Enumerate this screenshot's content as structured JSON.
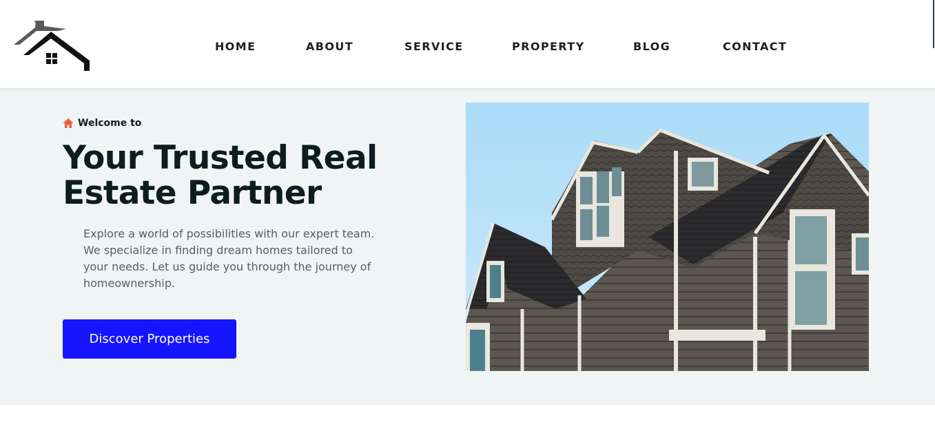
{
  "nav": {
    "items": [
      {
        "label": "HOME"
      },
      {
        "label": "ABOUT"
      },
      {
        "label": "SERVICE"
      },
      {
        "label": "PROPERTY"
      },
      {
        "label": "BLOG"
      },
      {
        "label": "CONTACT"
      }
    ]
  },
  "hero": {
    "welcome": "Welcome to",
    "title": "Your Trusted Real Estate Partner",
    "description": "Explore a world of possibilities with our expert team. We specialize in finding dream homes tailored to your needs. Let us guide you through the journey of homeownership.",
    "cta_label": "Discover Properties"
  },
  "colors": {
    "accent": "#1515ff",
    "welcome_icon": "#f15a3a",
    "hero_background": "#f1f4f5",
    "title_text": "#0c1c1f"
  },
  "icons": {
    "logo": "house-logo-icon",
    "welcome": "home-icon"
  }
}
